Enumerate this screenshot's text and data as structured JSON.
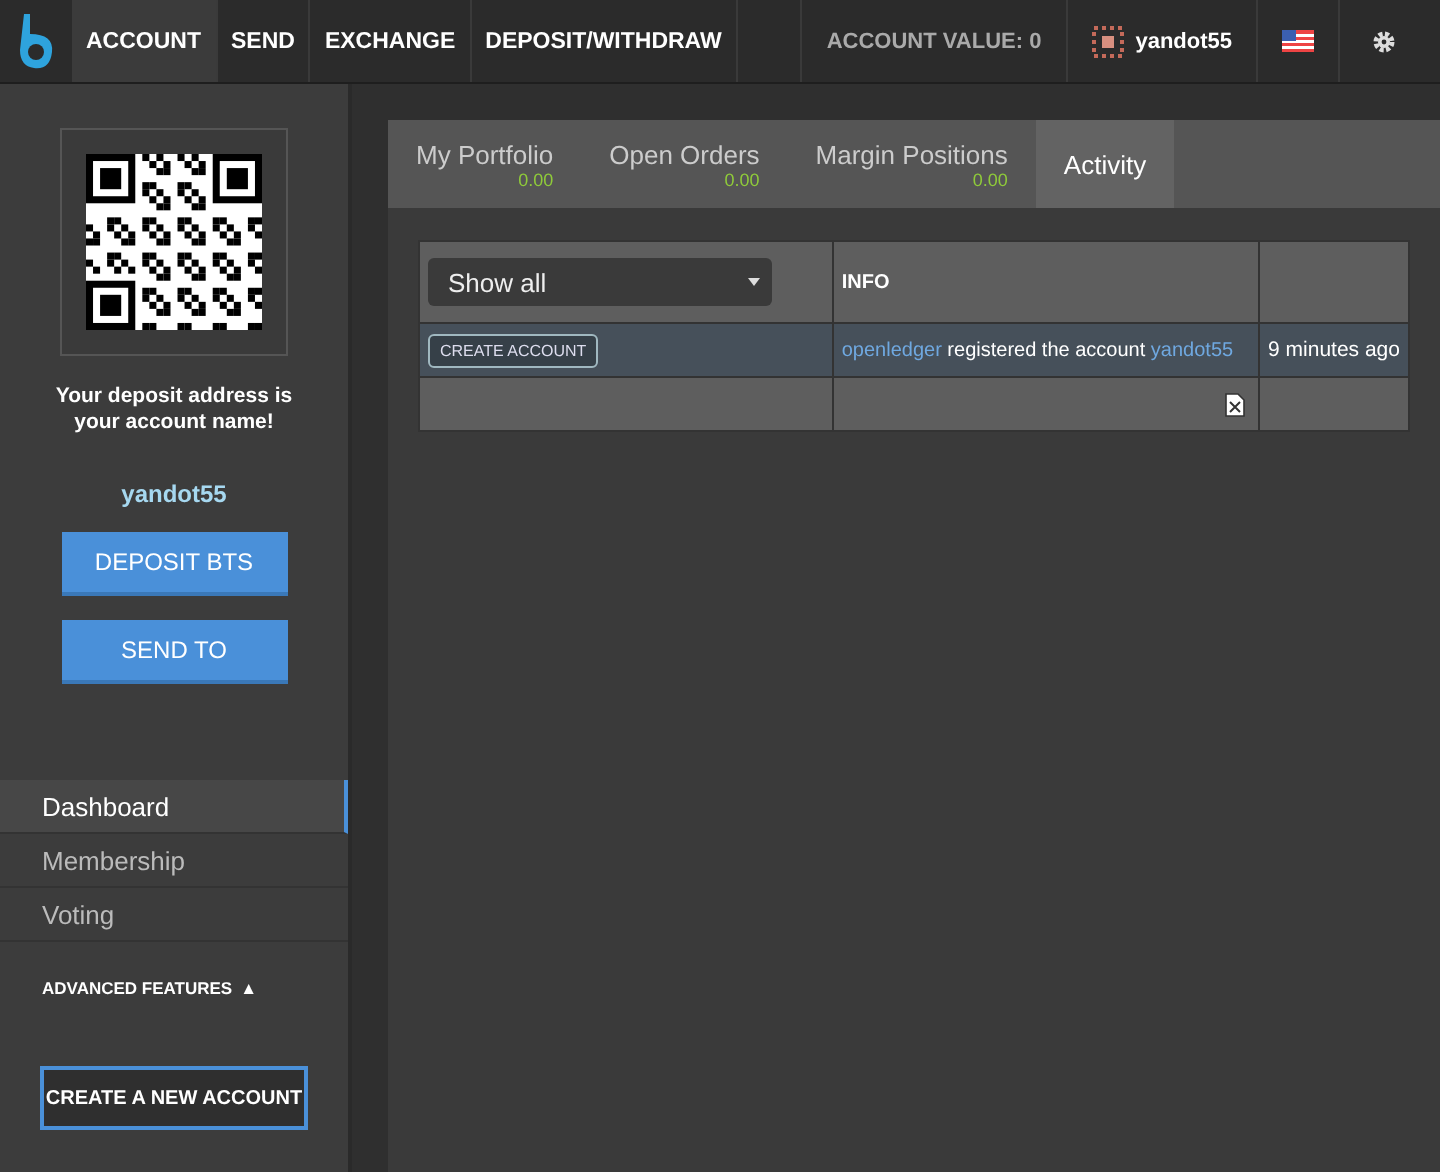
{
  "topbar": {
    "nav": [
      {
        "label": "ACCOUNT",
        "selected": true
      },
      {
        "label": "SEND",
        "selected": false
      },
      {
        "label": "EXCHANGE",
        "selected": false
      },
      {
        "label": "DEPOSIT/WITHDRAW",
        "selected": false
      }
    ],
    "account_value": "ACCOUNT VALUE: 0",
    "account_name": "yandot55"
  },
  "sidebar": {
    "deposit_note": "Your deposit address is your account name!",
    "account_name": "yandot55",
    "buttons": [
      "DEPOSIT BTS",
      "SEND TO"
    ],
    "menu": [
      {
        "label": "Dashboard",
        "selected": true
      },
      {
        "label": "Membership",
        "selected": false
      },
      {
        "label": "Voting",
        "selected": false
      }
    ],
    "advanced": {
      "label": "ADVANCED FEATURES",
      "toggle": "▲"
    },
    "create_button": "CREATE A NEW ACCOUNT"
  },
  "tabs": [
    {
      "label": "My Portfolio",
      "value": "0.00",
      "selected": false
    },
    {
      "label": "Open Orders",
      "value": "0.00",
      "selected": false
    },
    {
      "label": "Margin Positions",
      "value": "0.00",
      "selected": false
    },
    {
      "label": "Activity",
      "selected": true
    }
  ],
  "table": {
    "filter": "Show all",
    "columns": [
      "INFO"
    ],
    "rows": [
      {
        "type": "CREATE ACCOUNT",
        "info": {
          "from": "openledger",
          "text": "registered the account",
          "to": "yandot55"
        },
        "time": "9 minutes ago"
      }
    ]
  }
}
